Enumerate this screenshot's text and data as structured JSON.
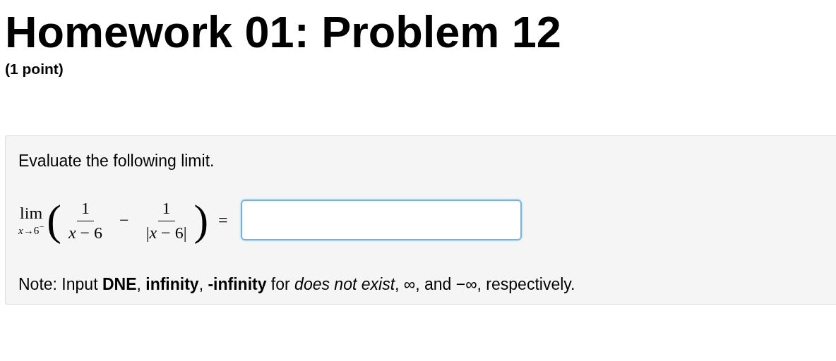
{
  "title": "Homework 01: Problem 12",
  "points": "(1 point)",
  "problem": {
    "prompt": "Evaluate the following limit.",
    "formula": {
      "limit": "lim",
      "under": "*x*→6$^{−}$",
      "open": "(",
      "terms": [
        {
          "numerator": "1",
          "denominator": "*x* − 6"
        },
        {
          "numerator": "1",
          "denominator": "|*x* − 6|"
        }
      ],
      "operator": "−",
      "close": ")",
      "equals": "="
    },
    "note": "Note: Input **DNE**, **infinity**, **-infinity** for *does not exist*, ∞, and −∞, respectively."
  }
}
